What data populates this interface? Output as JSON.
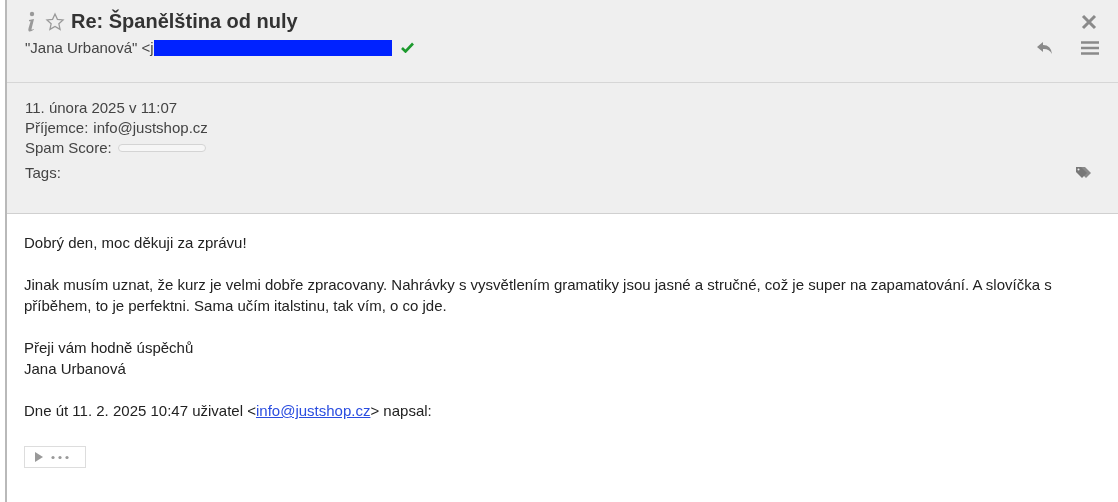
{
  "message": {
    "subject": "Re: Španělština od nuly",
    "starred": false,
    "sender": "\"Jana Urbanová\" <j",
    "verified": true,
    "date": "11. února 2025 v 11:07",
    "recipient_label": "Příjemce:",
    "recipient": "info@justshop.cz",
    "spam_label": "Spam Score:",
    "spam": {
      "level": 0
    },
    "tags_label": "Tags:"
  },
  "body": {
    "paragraphs": [
      {
        "lines": [
          "Dobrý den, moc děkuji za zprávu!"
        ]
      },
      {
        "lines": [
          "Jinak musím uznat, že kurz je velmi dobře zpracovany. Nahrávky s vysvětlením gramatiky jsou jasné a stručné, což je super na zapamatování. A slovíčka s příběhem, to je perfektni. Sama učím italstinu, tak vím, o co jde."
        ]
      },
      {
        "lines": [
          "Přeji vám hodně úspěchů",
          "Jana Urbanová"
        ]
      }
    ],
    "quote_intro": {
      "before": "Dne út 11. 2. 2025 10:47 uživatel <",
      "link": "info@justshop.cz",
      "after": "> napsal:"
    }
  }
}
